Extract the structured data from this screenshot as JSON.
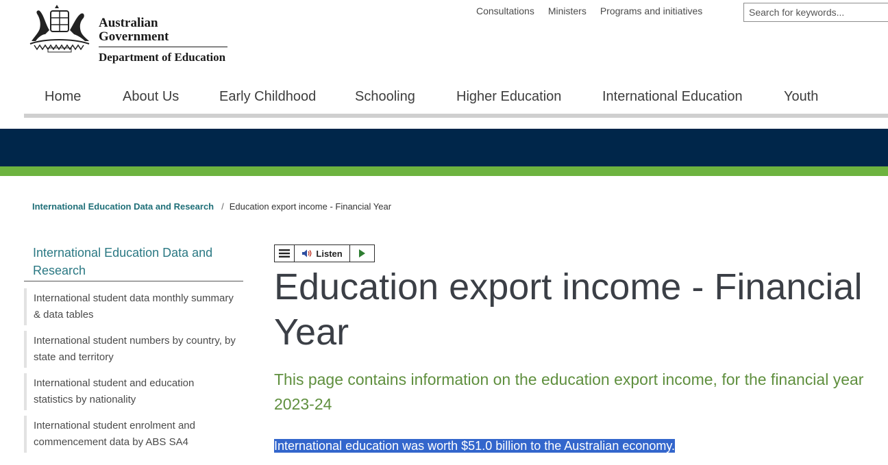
{
  "header": {
    "logo_line1": "Australian Government",
    "logo_line2": "Department of Education"
  },
  "utility_nav": [
    "Consultations",
    "Ministers",
    "Programs and initiatives"
  ],
  "search": {
    "placeholder": "Search for keywords..."
  },
  "main_nav": [
    "Home",
    "About Us",
    "Early Childhood",
    "Schooling",
    "Higher Education",
    "International Education",
    "Youth"
  ],
  "colors": {
    "banner_navy": "#00264a",
    "banner_green": "#6db33f",
    "link_teal": "#1f6f78",
    "lead_green": "#5f8f3e",
    "selection_blue": "#3366cc"
  },
  "breadcrumb": {
    "parent": "International Education Data and Research",
    "separator": "/",
    "current": "Education export income - Financial Year"
  },
  "sidebar": {
    "title": "International Education Data and Research",
    "items": [
      "International student data monthly summary & data tables",
      "International student numbers by country, by state and territory",
      "International student and education statistics by nationality",
      "International student enrolment and commencement data by ABS SA4"
    ]
  },
  "listen_toolbar": {
    "menu_icon": "menu-icon",
    "speaker_icon": "speaker-icon",
    "label": "Listen",
    "play_icon": "play-icon"
  },
  "content": {
    "title": "Education export income - Financial Year",
    "lead": "This page contains information on the education export income, for the financial year 2023-24",
    "highlighted_text": "International education was worth $51.0 billion to the Australian economy."
  }
}
